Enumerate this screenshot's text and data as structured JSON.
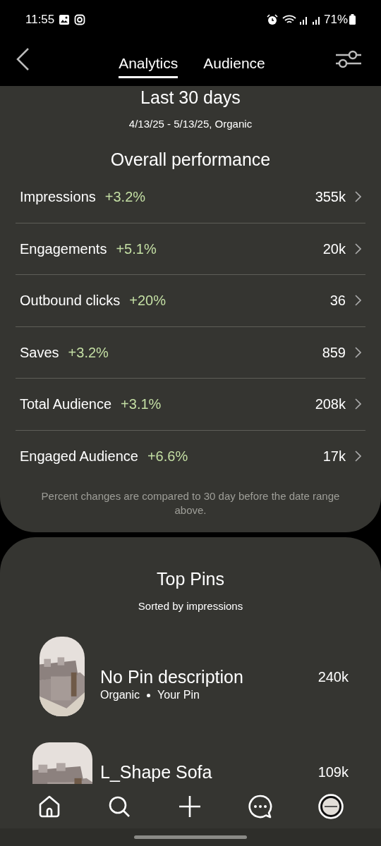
{
  "status_bar": {
    "time": "11:55",
    "battery": "71%"
  },
  "tabs": [
    {
      "label": "Analytics",
      "selected": true
    },
    {
      "label": "Audience",
      "selected": false
    }
  ],
  "period": {
    "title": "Last 30 days",
    "range": "4/13/25 - 5/13/25, Organic"
  },
  "overall": {
    "title": "Overall performance",
    "metrics": [
      {
        "name": "Impressions",
        "change": "+3.2%",
        "value": "355k"
      },
      {
        "name": "Engagements",
        "change": "+5.1%",
        "value": "20k"
      },
      {
        "name": "Outbound clicks",
        "change": "+20%",
        "value": "36"
      },
      {
        "name": "Saves",
        "change": "+3.2%",
        "value": "859"
      },
      {
        "name": "Total Audience",
        "change": "+3.1%",
        "value": "208k"
      },
      {
        "name": "Engaged Audience",
        "change": "+6.6%",
        "value": "17k"
      }
    ],
    "note": "Percent changes are compared to 30 day before the date range above."
  },
  "top_pins": {
    "title": "Top Pins",
    "subtitle": "Sorted by impressions",
    "pins": [
      {
        "title": "No Pin description",
        "source": "Organic",
        "owner": "Your Pin",
        "value": "240k"
      },
      {
        "title": "L_Shape Sofa",
        "value": "109k"
      }
    ]
  }
}
